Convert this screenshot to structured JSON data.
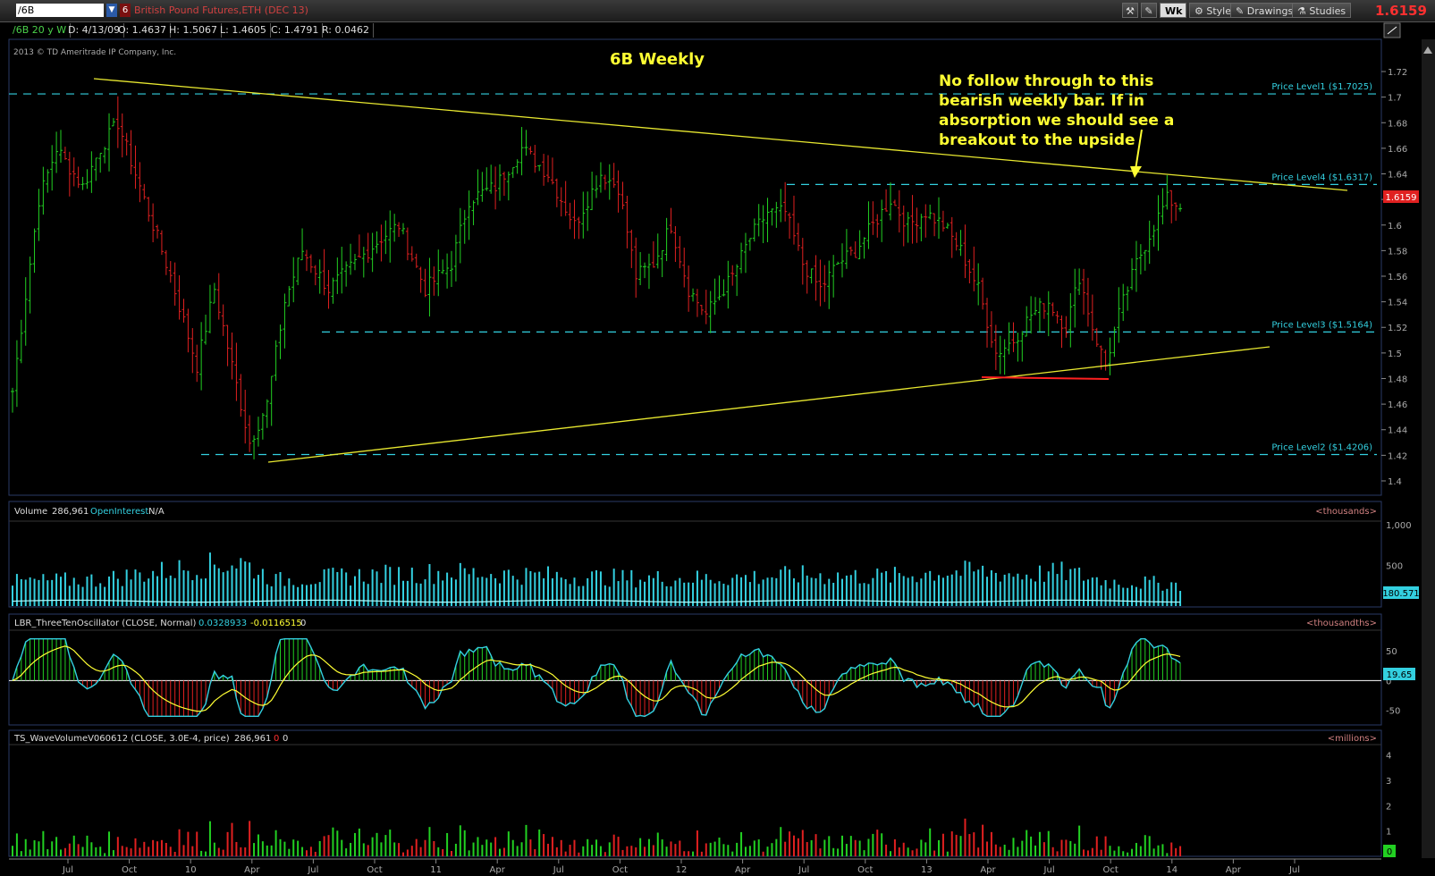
{
  "toolbar": {
    "symbol": "/6B",
    "link_number": "6",
    "instrument": "British Pound Futures,ETH (DEC 13)",
    "period": "Wk",
    "style": "Style",
    "drawings": "Drawings",
    "studies": "Studies",
    "last": "1.6159"
  },
  "info": {
    "chart": "/6B 20 y W",
    "date": "D: 4/13/09",
    "open": "O: 1.4637",
    "high": "H: 1.5067",
    "low": "L: 1.4605",
    "close": "C: 1.4791",
    "range": "R: 0.0462"
  },
  "copyright": "2013 © TD Ameritrade IP Company, Inc.",
  "colors": {
    "up": "#22d022",
    "down": "#e02020",
    "cyan": "#33d0e0",
    "yellow": "#ffff33",
    "trend": "#e8e830"
  },
  "chart_data": [
    {
      "type": "line",
      "subtype": "ohlc",
      "title": "6B Weekly",
      "y_ticks": [
        "1.72",
        "1.7",
        "1.68",
        "1.66",
        "1.64",
        "1.62",
        "1.6",
        "1.58",
        "1.56",
        "1.54",
        "1.52",
        "1.5",
        "1.48",
        "1.46",
        "1.44",
        "1.42",
        "1.4"
      ],
      "ylim": [
        1.393,
        1.727
      ],
      "x_ticks": [
        "Jul",
        "Oct",
        "10",
        "Apr",
        "Jul",
        "Oct",
        "11",
        "Apr",
        "Jul",
        "Oct",
        "12",
        "Apr",
        "Jul",
        "Oct",
        "13",
        "Apr",
        "Jul",
        "Oct",
        "14",
        "Apr",
        "Jul"
      ],
      "last_label": "1.6159",
      "price_levels": [
        {
          "label": "Price Level1 ($1.7025)",
          "value": 1.7025
        },
        {
          "label": "Price Level4 ($1.6317)",
          "value": 1.6317
        },
        {
          "label": "Price Level3 ($1.5164)",
          "value": 1.5164
        },
        {
          "label": "Price Level2 ($1.4206)",
          "value": 1.4206
        }
      ],
      "annotation": [
        "No follow through to this",
        "bearish weekly bar.  If in",
        "absorption we should see a",
        "breakout to the upside"
      ],
      "close_keypoints": [
        [
          0,
          1.47
        ],
        [
          6,
          1.62
        ],
        [
          10,
          1.66
        ],
        [
          16,
          1.63
        ],
        [
          20,
          1.66
        ],
        [
          24,
          1.68
        ],
        [
          30,
          1.62
        ],
        [
          36,
          1.56
        ],
        [
          42,
          1.49
        ],
        [
          46,
          1.55
        ],
        [
          50,
          1.49
        ],
        [
          54,
          1.43
        ],
        [
          58,
          1.46
        ],
        [
          62,
          1.54
        ],
        [
          66,
          1.58
        ],
        [
          72,
          1.55
        ],
        [
          78,
          1.57
        ],
        [
          84,
          1.59
        ],
        [
          88,
          1.6
        ],
        [
          94,
          1.55
        ],
        [
          100,
          1.57
        ],
        [
          104,
          1.62
        ],
        [
          110,
          1.63
        ],
        [
          116,
          1.66
        ],
        [
          122,
          1.64
        ],
        [
          128,
          1.6
        ],
        [
          134,
          1.64
        ],
        [
          138,
          1.63
        ],
        [
          142,
          1.56
        ],
        [
          146,
          1.57
        ],
        [
          150,
          1.6
        ],
        [
          154,
          1.55
        ],
        [
          158,
          1.53
        ],
        [
          164,
          1.56
        ],
        [
          168,
          1.59
        ],
        [
          172,
          1.61
        ],
        [
          176,
          1.61
        ],
        [
          180,
          1.57
        ],
        [
          184,
          1.55
        ],
        [
          188,
          1.57
        ],
        [
          192,
          1.58
        ],
        [
          196,
          1.6
        ],
        [
          200,
          1.62
        ],
        [
          204,
          1.6
        ],
        [
          208,
          1.61
        ],
        [
          212,
          1.6
        ],
        [
          216,
          1.58
        ],
        [
          220,
          1.55
        ],
        [
          224,
          1.5
        ],
        [
          228,
          1.51
        ],
        [
          232,
          1.53
        ],
        [
          236,
          1.54
        ],
        [
          240,
          1.52
        ],
        [
          243,
          1.56
        ],
        [
          246,
          1.52
        ],
        [
          249,
          1.49
        ],
        [
          252,
          1.53
        ],
        [
          256,
          1.57
        ],
        [
          260,
          1.6
        ],
        [
          263,
          1.62
        ],
        [
          266,
          1.615
        ]
      ]
    },
    {
      "type": "bar",
      "title": "Volume",
      "readout": "286,961",
      "oi_label": "OpenInterest",
      "oi_value": "N/A",
      "unit_label": "<thousands>",
      "y_ticks": [
        "1,000",
        "500"
      ],
      "ylim": [
        0,
        1000
      ],
      "last_label": "180.571",
      "volume_keypoints": [
        [
          0,
          330
        ],
        [
          20,
          360
        ],
        [
          40,
          520
        ],
        [
          52,
          600
        ],
        [
          60,
          350
        ],
        [
          80,
          420
        ],
        [
          100,
          460
        ],
        [
          120,
          420
        ],
        [
          140,
          380
        ],
        [
          160,
          380
        ],
        [
          180,
          420
        ],
        [
          200,
          400
        ],
        [
          210,
          460
        ],
        [
          220,
          470
        ],
        [
          230,
          430
        ],
        [
          240,
          460
        ],
        [
          250,
          330
        ],
        [
          266,
          300
        ]
      ]
    },
    {
      "type": "line",
      "title": "LBR_ThreeTenOscillator (CLOSE, Normal)",
      "readouts": [
        "0.0328933",
        "-0.0116515",
        "0"
      ],
      "unit_label": "<thousandths>",
      "y_ticks": [
        "50",
        "0",
        "-50"
      ],
      "ylim": [
        -70,
        80
      ],
      "last_label": "19.65"
    },
    {
      "type": "bar",
      "title": "TS_WaveVolumeV060612 (CLOSE, 3.0E-4, price)",
      "readouts": [
        "286,961",
        "0",
        "0"
      ],
      "unit_label": "<millions>",
      "y_ticks": [
        "4",
        "3",
        "2",
        "1"
      ],
      "ylim": [
        0,
        4.3
      ],
      "last_label": "0"
    }
  ]
}
